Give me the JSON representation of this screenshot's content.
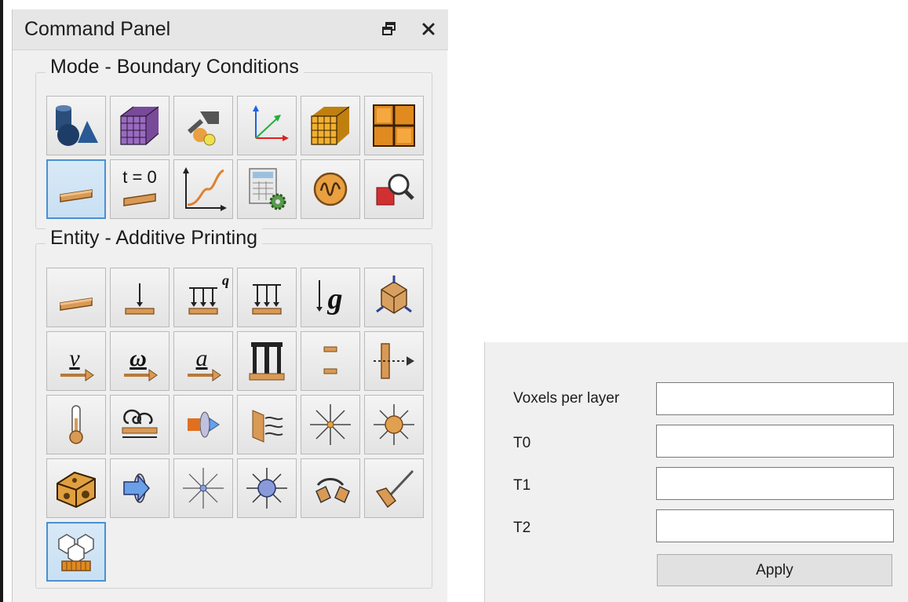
{
  "panel": {
    "title": "Command Panel",
    "float_icon": "float-window-icon",
    "close_icon": "close-icon"
  },
  "mode_group": {
    "title": "Mode - Boundary Conditions",
    "tools": [
      {
        "name": "geometry-mode-icon"
      },
      {
        "name": "mesh-mode-icon"
      },
      {
        "name": "materials-mode-icon"
      },
      {
        "name": "coordinate-systems-icon"
      },
      {
        "name": "mesh-grid-icon"
      },
      {
        "name": "grid-block-icon"
      },
      {
        "name": "boundary-conditions-icon",
        "active": true
      },
      {
        "name": "initial-conditions-icon",
        "text": "t = 0"
      },
      {
        "name": "functions-curve-icon"
      },
      {
        "name": "calculator-settings-icon"
      },
      {
        "name": "signal-wave-icon"
      },
      {
        "name": "inspect-zoom-icon"
      }
    ]
  },
  "entity_group": {
    "title": "Entity - Additive Printing",
    "tools": [
      {
        "name": "surface-plate-icon"
      },
      {
        "name": "force-icon"
      },
      {
        "name": "heat-flux-icon",
        "text": "q"
      },
      {
        "name": "pressure-icon"
      },
      {
        "name": "gravity-icon",
        "text": "g"
      },
      {
        "name": "node-constraint-icon"
      },
      {
        "name": "velocity-icon",
        "text": "v"
      },
      {
        "name": "angular-velocity-icon",
        "text": "ω"
      },
      {
        "name": "acceleration-icon",
        "text": "a"
      },
      {
        "name": "pillar-frame-icon"
      },
      {
        "name": "gap-contact-icon"
      },
      {
        "name": "displacement-arrow-icon"
      },
      {
        "name": "temperature-icon"
      },
      {
        "name": "convection-icon"
      },
      {
        "name": "heat-flow-icon"
      },
      {
        "name": "radiation-surface-icon"
      },
      {
        "name": "point-source-icon"
      },
      {
        "name": "sphere-source-icon"
      },
      {
        "name": "cheese-block-icon"
      },
      {
        "name": "flow-through-icon"
      },
      {
        "name": "point-emitter-icon"
      },
      {
        "name": "sphere-emitter-icon"
      },
      {
        "name": "hinge-joint-icon"
      },
      {
        "name": "brush-tool-icon"
      },
      {
        "name": "additive-printing-icon",
        "active": true
      }
    ]
  },
  "form": {
    "voxels_label": "Voxels per layer",
    "voxels_value": "",
    "t0_label": "T0",
    "t0_value": "",
    "t1_label": "T1",
    "t1_value": "",
    "t2_label": "T2",
    "t2_value": "",
    "apply_label": "Apply"
  }
}
